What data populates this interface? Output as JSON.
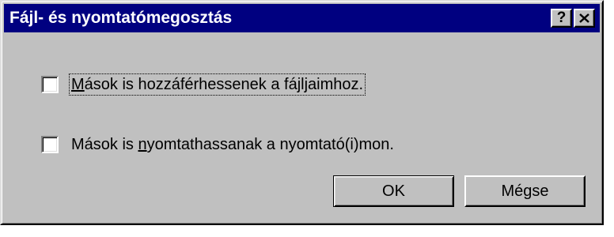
{
  "dialog": {
    "title": "Fájl- és nyomtatómegosztás",
    "help_label": "?",
    "close_icon": "close-icon"
  },
  "options": [
    {
      "label_before": "",
      "label_accel": "M",
      "label_after": "ások is hozzáférhessenek a fájljaimhoz.",
      "checked": false
    },
    {
      "label_before": "Mások is ",
      "label_accel": "n",
      "label_after": "yomtathassanak a nyomtató(i)mon.",
      "checked": false
    }
  ],
  "buttons": {
    "ok_label": "OK",
    "cancel_label": "Mégse"
  },
  "colors": {
    "titlebar": "#000080",
    "face": "#c0c0c0"
  }
}
